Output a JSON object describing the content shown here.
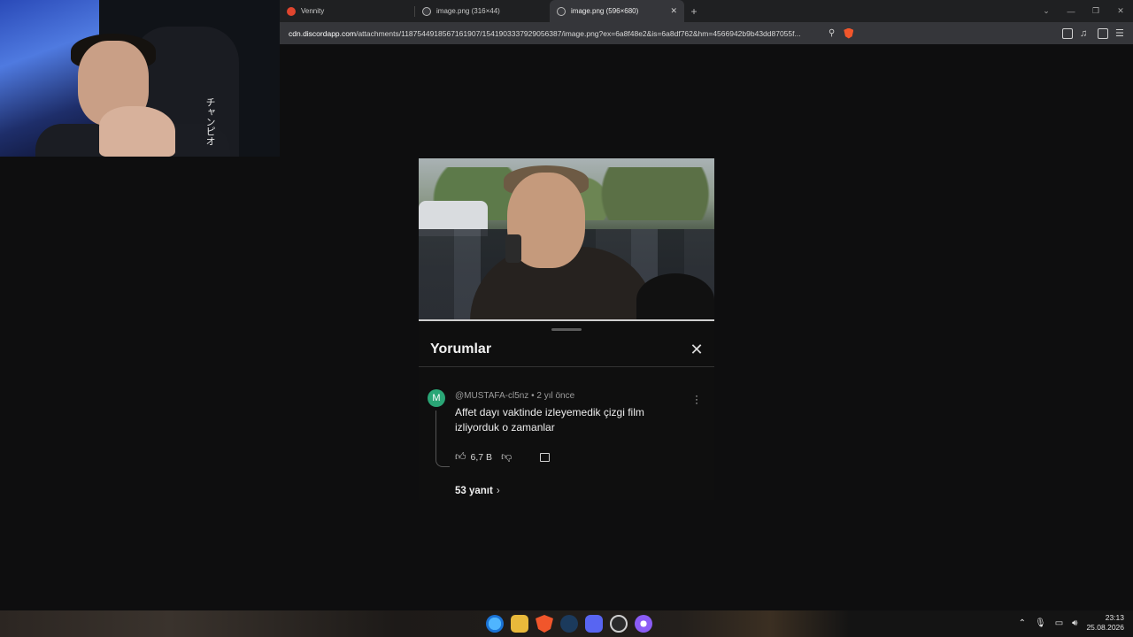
{
  "browser": {
    "tabs": [
      {
        "title": "Vennity",
        "active": false
      },
      {
        "title": "image.png (316×44)",
        "active": false
      },
      {
        "title": "image.png (596×680)",
        "active": true
      }
    ],
    "new_tab_symbol": "+",
    "tab_close_symbol": "✕",
    "url_host": "cdn.discordapp.com",
    "url_path": "/attachments/1187544918567161907/1541903337929056387/image.png?ex=6a8f48e2&is=6a8df762&hm=4566942b9b43dd87055f..."
  },
  "webcam": {
    "jp_text": "チャンピオ"
  },
  "comments_panel": {
    "title": "Yorumlar",
    "close_symbol": "✕",
    "comment": {
      "avatar_letter": "M",
      "author": "@MUSTAFA-cl5nz",
      "time": "2 yıl önce",
      "meta_sep": " • ",
      "text": "Affet dayı vaktinde izleyemedik çizgi film izliyorduk o zamanlar",
      "likes": "6,7 B",
      "replies": "53 yanıt"
    }
  },
  "taskbar": {
    "time": "23:13",
    "date": "25.08.2026"
  }
}
